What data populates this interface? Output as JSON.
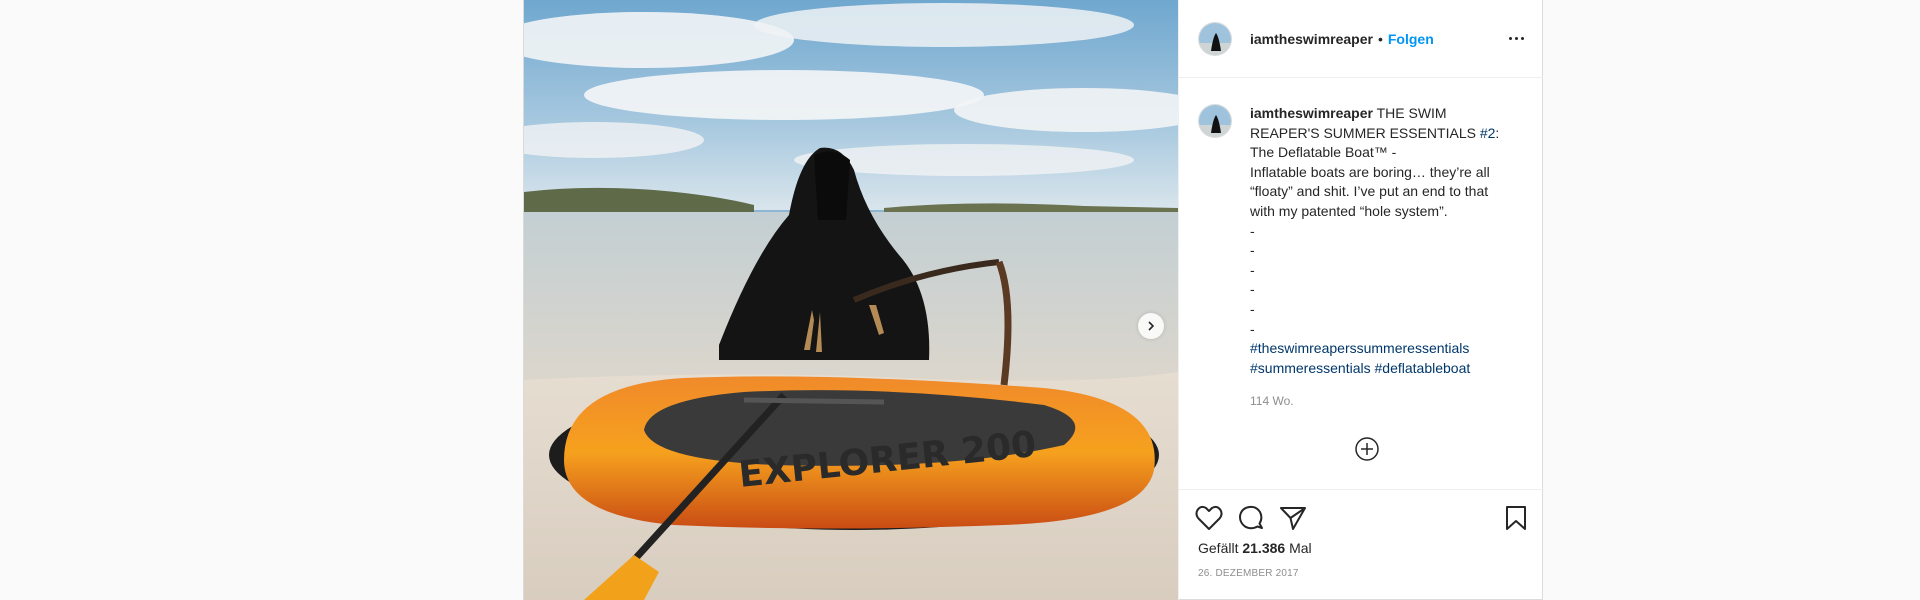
{
  "post": {
    "username": "iamtheswimreaper",
    "separator": "•",
    "follow_label": "Folgen",
    "caption_title": "THE SWIM REAPER'S SUMMER ESSENTIALS",
    "caption_hashtag_num": "#2",
    "caption_after": ": The Deflatable Boat™ -",
    "caption_body": "Inflatable boats are boring… they’re all “floaty” and shit. I’ve put an end to that with my patented “hole system”.",
    "dashes": [
      "-",
      "-",
      "-",
      "-",
      "-",
      "-"
    ],
    "hashtags": [
      "#theswimreaperssummeressentials",
      "#summeressentials",
      "#deflatableboat"
    ],
    "comment_time": "114 Wo.",
    "likes_prefix": "Gefällt",
    "likes_count": "21.386",
    "likes_suffix": "Mal",
    "date": "26. Dezember 2017"
  },
  "icons": {
    "more": "more-options-icon",
    "next": "chevron-right-icon",
    "load_more": "plus-circle-icon",
    "like": "heart-icon",
    "comment": "comment-icon",
    "share": "paper-plane-icon",
    "save": "bookmark-icon"
  },
  "colors": {
    "link": "#0095f6",
    "hashtag": "#00376b",
    "muted": "#8e8e8e",
    "border": "#dbdbdb"
  }
}
